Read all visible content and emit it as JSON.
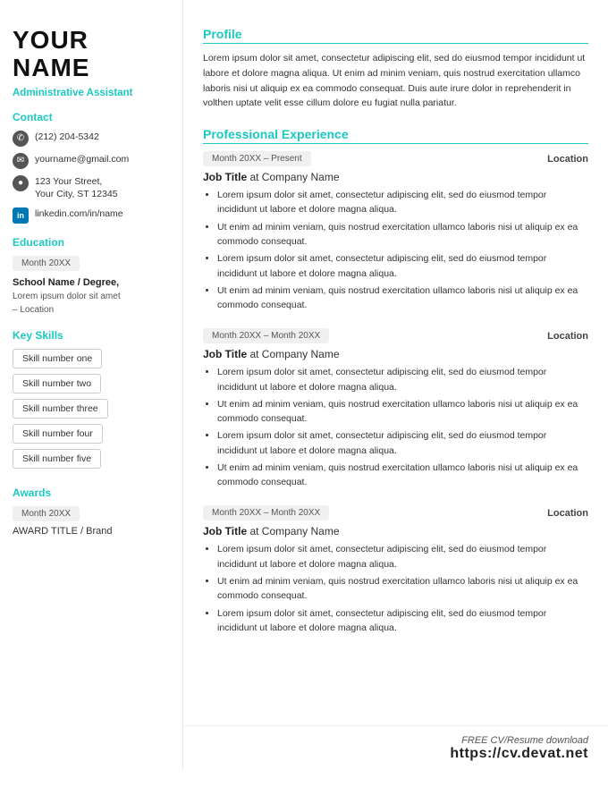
{
  "sidebar": {
    "name_line1": "YOUR",
    "name_line2": "NAME",
    "job_title": "Administrative Assistant",
    "contact_heading": "Contact",
    "contact_items": [
      {
        "type": "phone",
        "text": "(212) 204-5342"
      },
      {
        "type": "email",
        "text": "yourname@gmail.com"
      },
      {
        "type": "address",
        "text": "123 Your Street,\nYour City, ST 12345"
      },
      {
        "type": "linkedin",
        "text": "linkedin.com/in/name"
      }
    ],
    "education_heading": "Education",
    "education_badge": "Month 20XX",
    "school_name": "School Name / Degree,",
    "school_detail": "Lorem ipsum dolor sit amet\n– Location",
    "skills_heading": "Key Skills",
    "skills": [
      "Skill number one",
      "Skill number two",
      "Skill number three",
      "Skill number four",
      "Skill number five"
    ],
    "awards_heading": "Awards",
    "awards_badge": "Month 20XX",
    "award_title": "AWARD TITLE / Brand"
  },
  "main": {
    "profile_heading": "Profile",
    "profile_text": "Lorem ipsum dolor sit amet, consectetur adipiscing elit, sed do eiusmod tempor incididunt ut labore et dolore magna aliqua. Ut enim ad minim veniam, quis nostrud exercitation ullamco laboris nisi ut aliquip ex ea commodo consequat. Duis aute irure dolor in reprehenderit in volthen uptate velit esse cillum dolore eu fugiat nulla pariatur.",
    "experience_heading": "Professional Experience",
    "experiences": [
      {
        "date": "Month 20XX – Present",
        "location": "Location",
        "job_title": "Job Title",
        "company": "Company Name",
        "bullets": [
          "Lorem ipsum dolor sit amet, consectetur adipiscing elit, sed do eiusmod tempor incididunt ut labore et dolore magna aliqua.",
          "Ut enim ad minim veniam, quis nostrud exercitation ullamco laboris nisi ut aliquip ex ea commodo consequat.",
          "Lorem ipsum dolor sit amet, consectetur adipiscing elit, sed do eiusmod tempor incididunt ut labore et dolore magna aliqua.",
          "Ut enim ad minim veniam, quis nostrud exercitation ullamco laboris nisi ut aliquip ex ea commodo consequat."
        ]
      },
      {
        "date": "Month 20XX – Month 20XX",
        "location": "Location",
        "job_title": "Job Title",
        "company": "Company Name",
        "bullets": [
          "Lorem ipsum dolor sit amet, consectetur adipiscing elit, sed do eiusmod tempor incididunt ut labore et dolore magna aliqua.",
          "Ut enim ad minim veniam, quis nostrud exercitation ullamco laboris nisi ut aliquip ex ea commodo consequat.",
          "Lorem ipsum dolor sit amet, consectetur adipiscing elit, sed do eiusmod tempor incididunt ut labore et dolore magna aliqua.",
          "Ut enim ad minim veniam, quis nostrud exercitation ullamco laboris nisi ut aliquip ex ea commodo consequat."
        ]
      },
      {
        "date": "Month 20XX – Month 20XX",
        "location": "Location",
        "job_title": "Job Title",
        "company": "Company Name",
        "bullets": [
          "Lorem ipsum dolor sit amet, consectetur adipiscing elit, sed do eiusmod tempor incididunt ut labore et dolore magna aliqua.",
          "Ut enim ad minim veniam, quis nostrud exercitation ullamco laboris nisi ut aliquip ex ea commodo consequat.",
          "Lorem ipsum dolor sit amet, consectetur adipiscing elit, sed do eiusmod tempor incididunt ut labore et dolore magna aliqua."
        ]
      }
    ]
  },
  "footer": {
    "free_label": "FREE CV/Resume download",
    "url": "https://cv.devat.net"
  }
}
